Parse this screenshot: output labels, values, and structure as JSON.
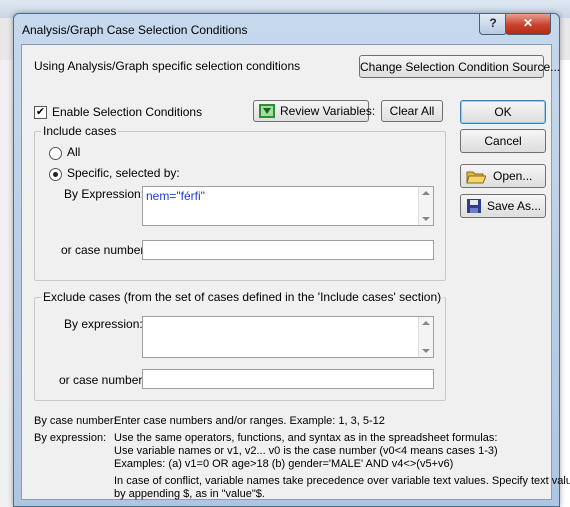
{
  "dialog": {
    "title": "Analysis/Graph Case Selection Conditions"
  },
  "titlebar": {
    "help_label": "?",
    "close_label": "✕"
  },
  "top": {
    "description": "Using Analysis/Graph specific selection conditions",
    "change_source_label": "Change Selection Condition Source..."
  },
  "enable": {
    "label": "Enable Selection Conditions",
    "checked": true
  },
  "buttons": {
    "review_label": "Review Variables:",
    "clear_all_label": "Clear All",
    "ok_label": "OK",
    "cancel_label": "Cancel",
    "open_label": "Open...",
    "save_as_label": "Save As..."
  },
  "include": {
    "legend": "Include cases",
    "all_label": "All",
    "specific_label": "Specific, selected by:",
    "selected": "specific",
    "by_expression_label": "By Expression:",
    "expression_value": "nem=\"férfi\"",
    "case_number_label": "or case number:",
    "case_number_value": ""
  },
  "exclude": {
    "legend": "Exclude cases (from the set of cases defined in the 'Include cases' section)",
    "by_expression_label": "By expression:",
    "expression_value": "",
    "case_number_label": "or case number:",
    "case_number_value": ""
  },
  "help": {
    "case_number_label": "By case number:",
    "case_number_text": "Enter case numbers and/or ranges.  Example:  1, 3, 5-12",
    "expression_label": "By expression:",
    "expression_line1": "Use the same operators, functions, and syntax as in the spreadsheet formulas:",
    "expression_line2": "Use variable names or v1, v2...   v0 is the case number  (v0<4 means cases 1-3)",
    "expression_line3": "Examples:   (a) v1=0 OR age>18   (b) gender='MALE' AND v4<>(v5+v6)",
    "conflict_line1": "In case of conflict, variable names take precedence over variable text values. Specify text values",
    "conflict_line2": "by appending $, as in \"value\"$."
  }
}
